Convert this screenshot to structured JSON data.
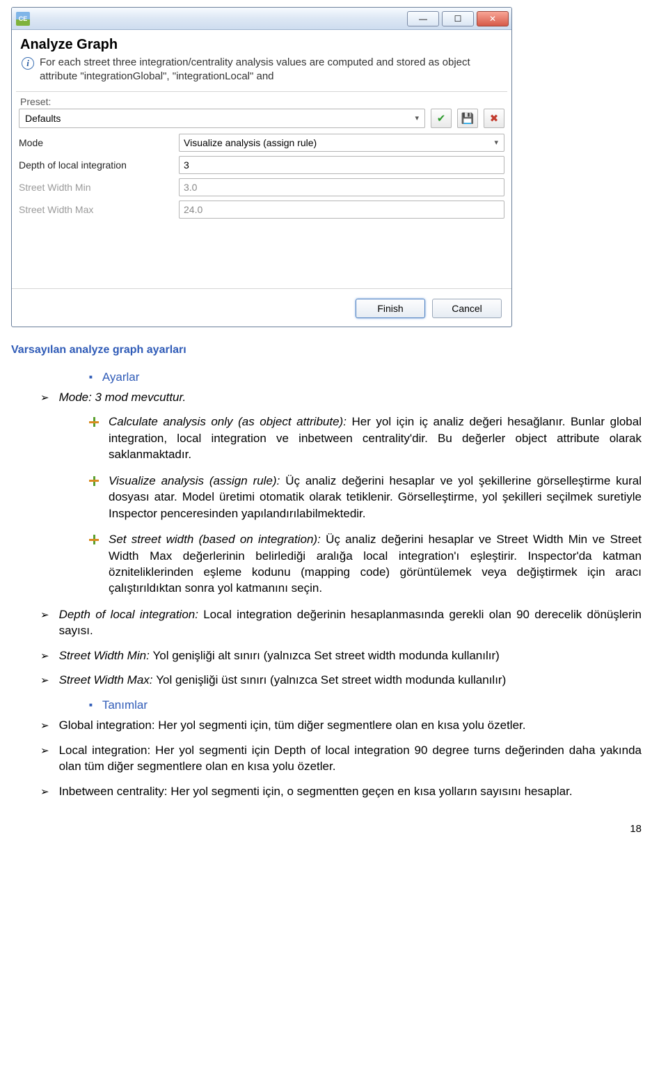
{
  "window": {
    "app_icon_text": "CE",
    "title": "Analyze Graph",
    "info_text": "For each street three integration/centrality analysis values are computed and stored as object attribute \"integrationGlobal\", \"integrationLocal\" and",
    "preset_label": "Preset:",
    "preset_value": "Defaults",
    "fields": {
      "mode_label": "Mode",
      "mode_value": "Visualize analysis (assign rule)",
      "depth_label": "Depth of local integration",
      "depth_value": "3",
      "swmin_label": "Street Width Min",
      "swmin_value": "3.0",
      "swmax_label": "Street Width Max",
      "swmax_value": "24.0"
    },
    "buttons": {
      "finish": "Finish",
      "cancel": "Cancel"
    }
  },
  "caption": "Varsayılan analyze graph ayarları",
  "section_ayarla": "Ayarlar",
  "arrow_mode": "Mode: 3 mod mevcuttur.",
  "plus_items": [
    {
      "prefix": "Calculate analysis only (as object attribute): ",
      "body": "Her yol için iç analiz değeri hesağlanır. Bunlar global integration, local integration ve inbetween centrality'dir. Bu değerler object attribute olarak saklanmaktadır."
    },
    {
      "prefix": "Visualize analysis (assign rule): ",
      "body": "Üç analiz değerini hesaplar ve yol şekillerine görselleştirme kural dosyası atar. Model üretimi otomatik olarak tetiklenir. Görselleştirme, yol şekilleri seçilmek suretiyle Inspector penceresinden yapılandırılabilmektedir."
    },
    {
      "prefix": "Set street width (based on integration): ",
      "body": "Üç analiz değerini hesaplar ve Street Width Min ve Street Width Max değerlerinin belirlediği aralığa local integration'ı eşleştirir. Inspector'da katman özniteliklerinden eşleme kodunu (mapping code) görüntülemek veya değiştirmek için aracı çalıştırıldıktan sonra yol katmanını seçin."
    }
  ],
  "arrows_lower": [
    {
      "prefix": "Depth of local integration: ",
      "body": "Local integration değerinin hesaplanmasında gerekli olan 90 derecelik dönüşlerin sayısı."
    },
    {
      "prefix": "Street Width Min: ",
      "body": "Yol genişliği alt sınırı (yalnızca Set street width modunda kullanılır)"
    },
    {
      "prefix": "Street Width Max: ",
      "body": "Yol genişliği üst sınırı (yalnızca Set street width modunda kullanılır)"
    }
  ],
  "section_tanimlar": "Tanımlar",
  "defs": [
    "Global integration: Her yol segmenti için, tüm diğer segmentlere olan en kısa yolu özetler.",
    "Local integration: Her yol segmenti için Depth of local integration 90 degree turns değerinden daha yakında olan tüm diğer segmentlere olan en kısa yolu özetler.",
    "Inbetween centrality: Her yol segmenti için, o segmentten geçen en kısa yolların sayısını hesaplar."
  ],
  "page_number": "18"
}
